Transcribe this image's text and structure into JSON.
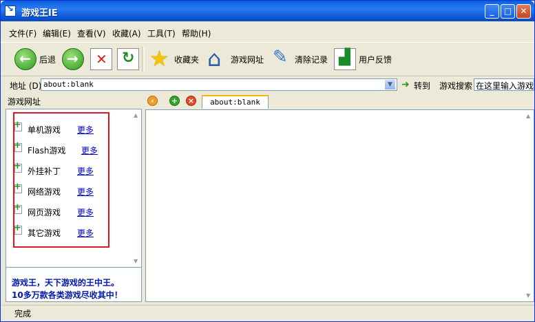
{
  "window": {
    "title": "游戏王IE"
  },
  "menu": [
    "文件(F)",
    "编辑(E)",
    "查看(V)",
    "收藏(A)",
    "工具(T)",
    "帮助(H)"
  ],
  "toolbar": {
    "back": "后退",
    "favorites": "收藏夹",
    "game_sites": "游戏网址",
    "clear": "清除记录",
    "feedback": "用户反馈"
  },
  "address": {
    "label": "地址 (D)",
    "value": "about:blank",
    "go": "转到",
    "search_label": "游戏搜索",
    "search_value": "在这里输入游戏"
  },
  "sidebar": {
    "title": "游戏网址",
    "items": [
      {
        "name": "单机游戏",
        "more": "更多"
      },
      {
        "name": "Flash游戏",
        "more": "更多"
      },
      {
        "name": "外挂补丁",
        "more": "更多"
      },
      {
        "name": "网络游戏",
        "more": "更多"
      },
      {
        "name": "网页游戏",
        "more": "更多"
      },
      {
        "name": "其它游戏",
        "more": "更多"
      }
    ],
    "promo_line1": "游戏王，天下游戏的王中王。",
    "promo_line2": "10多万款各类游戏尽收其中！"
  },
  "tabs": [
    {
      "label": "about:blank"
    }
  ],
  "status": {
    "text": "完成"
  },
  "colors": {
    "title_bar": "#0a5fdd",
    "highlight_box": "#e0161c",
    "link": "#0000cc",
    "promo_text": "#0018a8"
  }
}
